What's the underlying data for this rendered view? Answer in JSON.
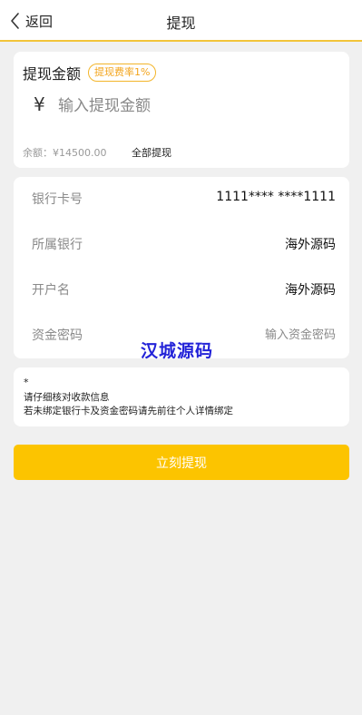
{
  "header": {
    "back_label": "返回",
    "title": "提现"
  },
  "amount_card": {
    "label": "提现金额",
    "fee_badge": "提现费率1%",
    "currency_symbol": "¥",
    "input_placeholder": "输入提现金额",
    "balance": "余额：¥14500.00",
    "withdraw_all": "全部提现"
  },
  "bank_card": {
    "rows": [
      {
        "label": "银行卡号",
        "value": "1111**** ****1111"
      },
      {
        "label": "所属银行",
        "value": "海外源码"
      },
      {
        "label": "开户名",
        "value": "海外源码"
      },
      {
        "label": "资金密码",
        "placeholder": "输入资金密码"
      }
    ]
  },
  "watermark": "汉城源码",
  "notes": {
    "star": "*",
    "line1": "请仔细核对收款信息",
    "line2": "若未绑定银行卡及资金密码请先前往个人详情绑定"
  },
  "submit_label": "立刻提现",
  "colors": {
    "accent": "#fcc400",
    "badge": "#f3b52a",
    "header_line": "#f2c43a",
    "watermark": "#2323d8"
  }
}
